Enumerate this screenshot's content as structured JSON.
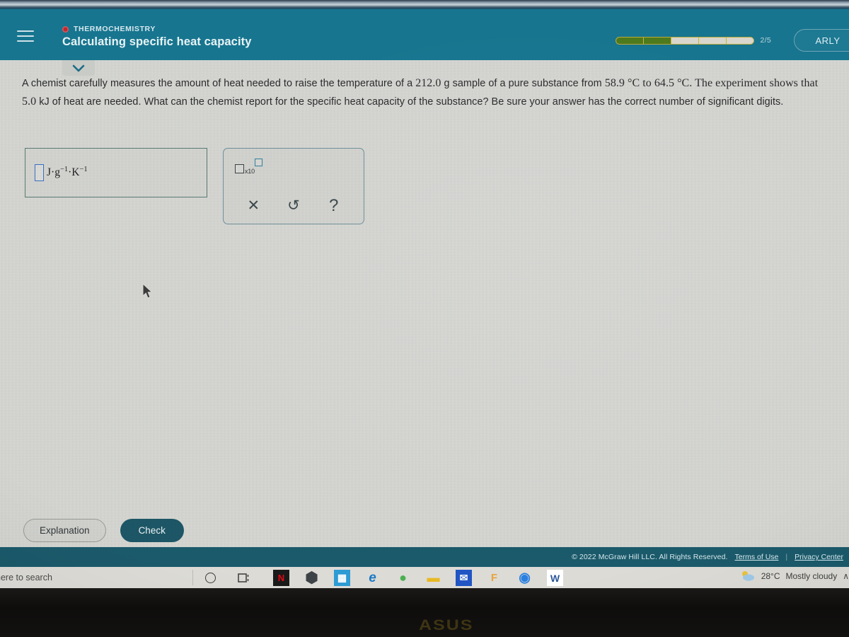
{
  "header": {
    "menu_icon": "hamburger-icon",
    "eyebrow": "THERMOCHEMISTRY",
    "title": "Calculating specific heat capacity",
    "progress_count": "2/5",
    "progress_total": 5,
    "progress_done": 2,
    "user_label": "ARLY"
  },
  "question": {
    "part1": "A chemist carefully measures the amount of heat needed to raise the temperature of a ",
    "mass": "212.0",
    "part2": " g sample of a pure substance from ",
    "temp_start": "58.9",
    "part3": " °C to ",
    "temp_end": "64.5",
    "part4": " °C. The experiment shows that ",
    "heat": "5.0",
    "part5": " kJ of heat are needed. What can the chemist report for the specific heat capacity of the substance? Be sure your answer has the correct number of significant digits."
  },
  "answer": {
    "value": "",
    "placeholder": "",
    "units_prefix": "J·g",
    "units_exp1": "−1",
    "units_mid": "·K",
    "units_exp2": "−1"
  },
  "palette": {
    "scientific_notation_label": "x10",
    "buttons": [
      {
        "name": "clear-button",
        "glyph": "✕"
      },
      {
        "name": "undo-button",
        "glyph": "↺"
      },
      {
        "name": "help-button",
        "glyph": "?"
      }
    ]
  },
  "actions": {
    "explanation_label": "Explanation",
    "check_label": "Check"
  },
  "footer": {
    "copyright": "© 2022 McGraw Hill LLC. All Rights Reserved.",
    "terms_label": "Terms of Use",
    "separator": "|",
    "privacy_label": "Privacy Center"
  },
  "taskbar": {
    "search_text": "here to search",
    "cortana_icon": "cortana-circle-icon",
    "taskview_icon": "task-view-icon",
    "apps": [
      {
        "name": "netflix-taskbar-icon",
        "glyph": "N",
        "fg": "#e50914",
        "bg": "#1a1a1a"
      },
      {
        "name": "hexagon-app-taskbar-icon",
        "glyph": "⬢",
        "fg": "#3e4347",
        "bg": "transparent"
      },
      {
        "name": "calculator-app-taskbar-icon",
        "glyph": "▦",
        "fg": "#ffffff",
        "bg": "#2d9bd4"
      },
      {
        "name": "microsoft-edge-taskbar-icon",
        "glyph": "e",
        "fg": "#1b79c4",
        "bg": "transparent"
      },
      {
        "name": "google-chrome-taskbar-icon",
        "glyph": "●",
        "fg": "#4caf50",
        "bg": "transparent"
      },
      {
        "name": "file-explorer-taskbar-icon",
        "glyph": "▬",
        "fg": "#e8b923",
        "bg": "transparent"
      },
      {
        "name": "mail-taskbar-icon",
        "glyph": "✉",
        "fg": "#ffffff",
        "bg": "#2255c4"
      },
      {
        "name": "foxit-reader-taskbar-icon",
        "glyph": "F",
        "fg": "#e8a33d",
        "bg": "transparent"
      },
      {
        "name": "opera-taskbar-icon",
        "glyph": "◉",
        "fg": "#2a7fe0",
        "bg": "transparent"
      },
      {
        "name": "microsoft-word-taskbar-icon",
        "glyph": "W",
        "fg": "#2b579a",
        "bg": "#ffffff"
      }
    ],
    "temperature": "28°C",
    "weather_condition": "Mostly cloudy",
    "tray_chevron": "∧"
  },
  "device": {
    "brand_logo": "ASUS"
  },
  "colors": {
    "header_teal": "#17758f",
    "footer_teal": "#1b5a6b",
    "check_button": "#1d5767",
    "progress_green": "#4e7a1d",
    "eyebrow_dot_red": "#c1262e",
    "input_border_blue": "#3a6fc4",
    "screen_background": "#d5d6d2"
  }
}
